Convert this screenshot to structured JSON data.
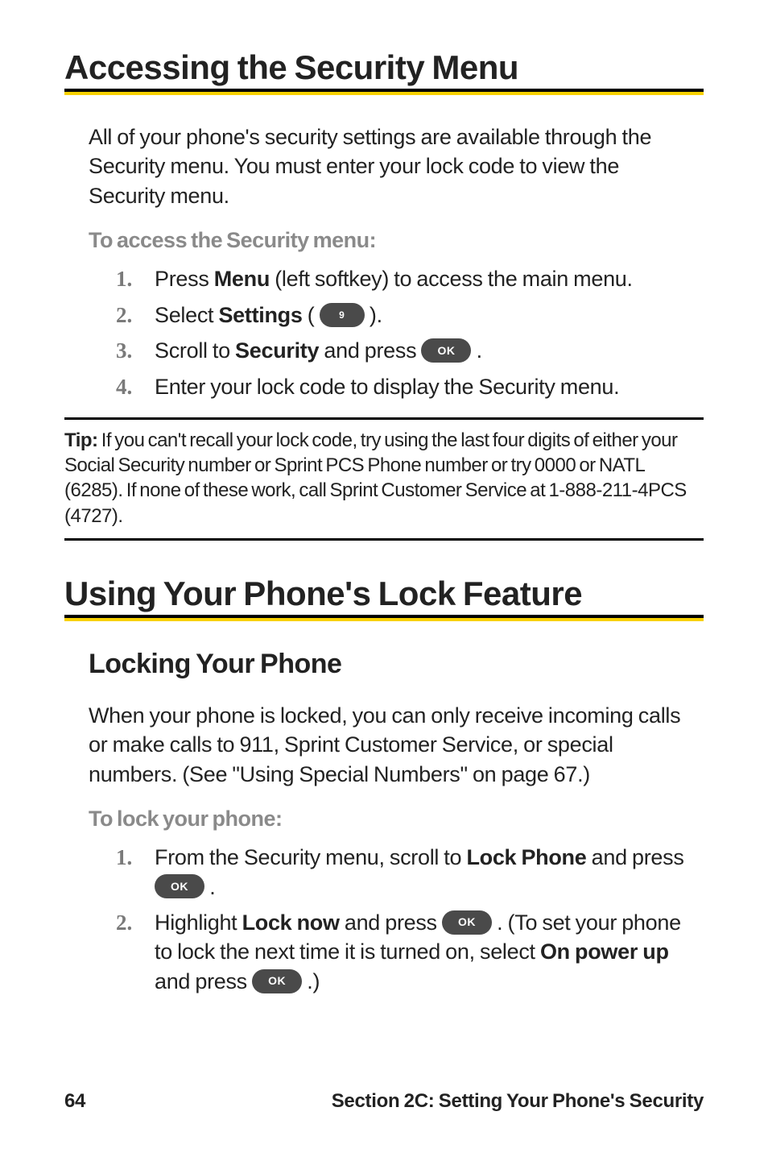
{
  "section1": {
    "title": "Accessing the Security Menu",
    "intro": "All of your phone's security settings are available through the Security menu. You must enter your lock code to view the Security menu.",
    "lead": "To access the Security menu:",
    "steps": {
      "s1": {
        "num": "1.",
        "pre": "Press ",
        "bold": "Menu",
        "post": " (left softkey) to access the main menu."
      },
      "s2": {
        "num": "2.",
        "pre": "Select ",
        "bold": "Settings",
        "post1": " ( ",
        "pill": "9",
        "post2": " )."
      },
      "s3": {
        "num": "3.",
        "pre": "Scroll to ",
        "bold": "Security",
        "post1": " and press ",
        "pill": "OK",
        "post2": " ."
      },
      "s4": {
        "num": "4.",
        "text": "Enter your lock code to display the Security menu."
      }
    }
  },
  "tip": {
    "label": "Tip:",
    "text": " If you can't recall your lock code, try using the last four digits of either your Social Security number or Sprint PCS Phone number or try 0000 or NATL (6285). If none of these work, call Sprint Customer Service at 1-888-211-4PCS (4727)."
  },
  "section2": {
    "title": "Using Your Phone's Lock Feature",
    "subhead": "Locking Your Phone",
    "intro": "When your phone is locked, you can only receive incoming calls or make calls to 911, Sprint Customer Service, or special numbers. (See \"Using Special Numbers\" on page 67.)",
    "lead": "To lock your phone:",
    "steps": {
      "s1": {
        "num": "1.",
        "pre": "From the Security menu, scroll to ",
        "bold": "Lock Phone",
        "mid": " and press ",
        "pill": "OK",
        "post": " ."
      },
      "s2": {
        "num": "2.",
        "pre": "Highlight ",
        "bold1": "Lock now",
        "mid1": " and press ",
        "pill1": "OK",
        "mid2": " . (To set your phone to lock the next time it is turned on, select ",
        "bold2": "On power up",
        "mid3": " and press ",
        "pill2": "OK",
        "post": " .)"
      }
    }
  },
  "footer": {
    "page": "64",
    "title": "Section 2C: Setting Your Phone's Security"
  }
}
